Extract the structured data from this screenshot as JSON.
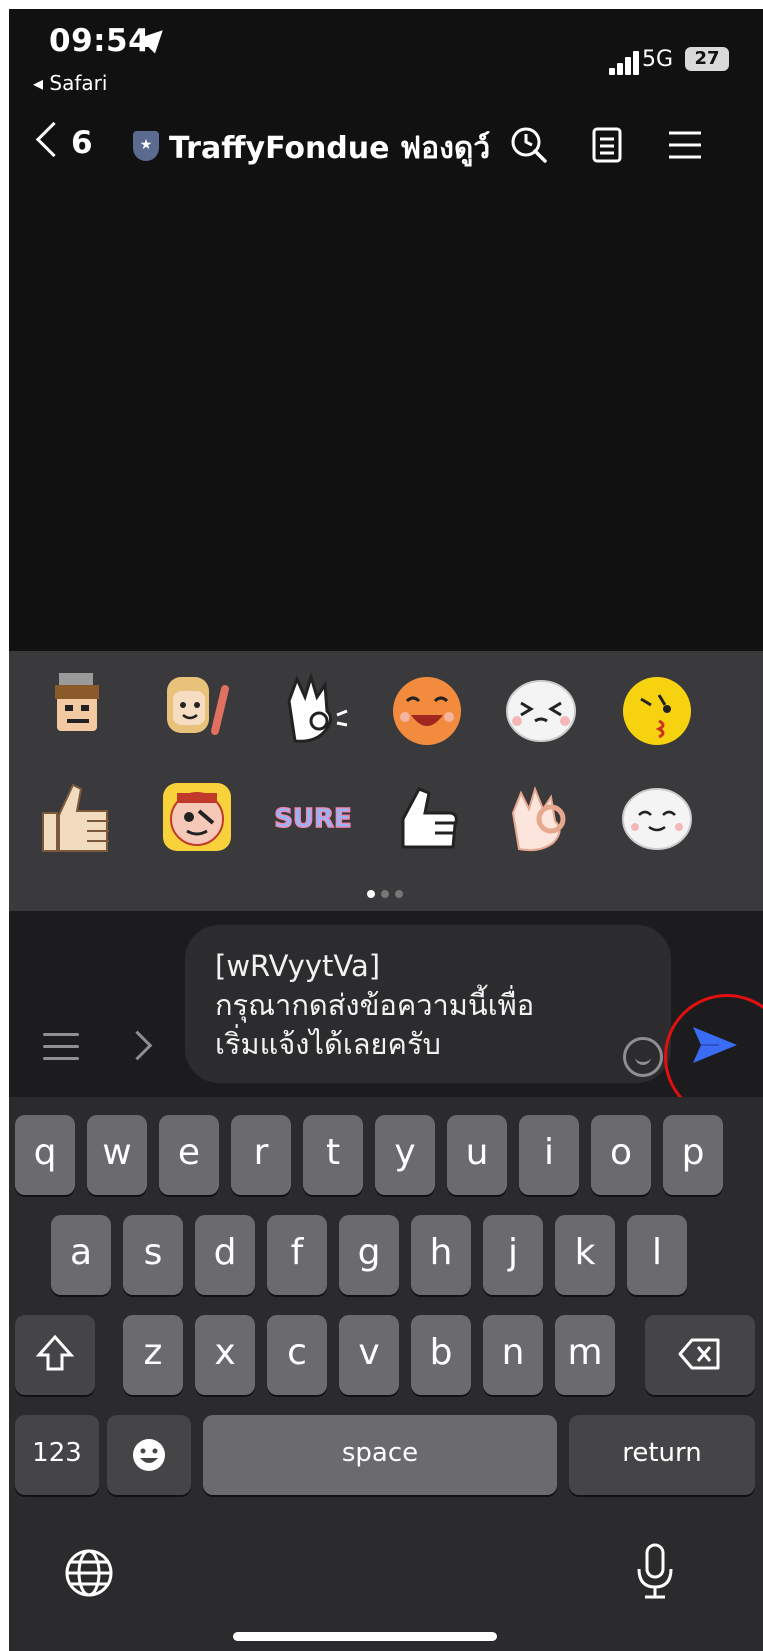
{
  "status": {
    "time": "09:54",
    "back_app": "◂ Safari",
    "network": "5G",
    "battery": "27"
  },
  "header": {
    "back_count": "6",
    "badge": "★",
    "title": "TraffyFondue ฟองดูว์"
  },
  "stickers": [
    "sticker-king",
    "sticker-girl-wave",
    "sticker-ok-hand",
    "sticker-laughing-face",
    "sticker-squint-face",
    "sticker-kiss-face",
    "sticker-thumbs-up",
    "sticker-pirate-face",
    "sticker-sure-text",
    "sticker-thumbs-up-white",
    "sticker-ok-hand-pink",
    "sticker-smiling-face"
  ],
  "composer": {
    "message": "[wRVyytVa]\nกรุณากดส่งข้อความนี้เพื่อ\nเริ่มแจ้งได้เลยครับ"
  },
  "keyboard": {
    "row1": [
      "q",
      "w",
      "e",
      "r",
      "t",
      "y",
      "u",
      "i",
      "o",
      "p"
    ],
    "row2": [
      "a",
      "s",
      "d",
      "f",
      "g",
      "h",
      "j",
      "k",
      "l"
    ],
    "row3": [
      "z",
      "x",
      "c",
      "v",
      "b",
      "n",
      "m"
    ],
    "numbers": "123",
    "space": "space",
    "return": "return"
  },
  "colors": {
    "accent": "#3b6cf6",
    "highlight_ring": "#e01010"
  }
}
